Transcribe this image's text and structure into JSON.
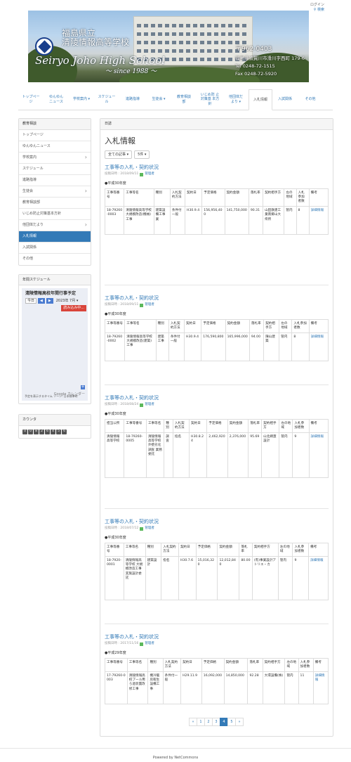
{
  "topbar": {
    "login": "ログイン",
    "search": "検索"
  },
  "header": {
    "school_jp_1": "福島県立",
    "school_jp_2": "清陵情報高等学校",
    "school_en": "Seiryo Joho High School",
    "since": "～ since 1988 ～",
    "zip": "〒962-0403",
    "address": "福島県須賀川市滑川字西町 179-6",
    "tel": "Tel 0248-72-1515",
    "fax": "Fax 0248-72-5920"
  },
  "nav": [
    {
      "label": "トップペー ジ"
    },
    {
      "label": "ゆんゆん ニュース"
    },
    {
      "label": "学校案内 ▾"
    },
    {
      "label": "スケジュー ル"
    },
    {
      "label": "進路指導"
    },
    {
      "label": "生徒会 ▾"
    },
    {
      "label": "教育相談 部"
    },
    {
      "label": "いじめ防 止対策基 本方針"
    },
    {
      "label": "他団体だ より ▾"
    },
    {
      "label": "入札情報"
    },
    {
      "label": "入試関係"
    },
    {
      "label": "その他"
    }
  ],
  "sidebar": {
    "menu_title": "教育相談",
    "items": [
      {
        "label": "トップページ"
      },
      {
        "label": "ゆんゆんニュース"
      },
      {
        "label": "学校案内"
      },
      {
        "label": "スケジュール"
      },
      {
        "label": "進路指導"
      },
      {
        "label": "生徒会"
      },
      {
        "label": "教育相談部"
      },
      {
        "label": "いじめ防止対策基本方針"
      },
      {
        "label": "他団体だより"
      },
      {
        "label": "入札情報"
      },
      {
        "label": "入試関係"
      },
      {
        "label": "その他"
      }
    ],
    "schedule_title": "年間スケジュール",
    "calendar_title": "清陵情報高校年間行事予定",
    "calendar_today": "今日",
    "calendar_prev": "◀",
    "calendar_next": "▶",
    "calendar_month": "2023年 7月 ▾",
    "calendar_loading": "読み込み中...",
    "calendar_footer": "予定を表示するタイム ゾーン: 日本標準時",
    "calendar_google": "Google カレンダー",
    "counter_title": "カウンタ",
    "counter_digits": [
      "0",
      "0",
      "8",
      "2",
      "6",
      "4",
      "5",
      "6"
    ]
  },
  "main": {
    "breadcrumb": "日誌",
    "title": "入札情報",
    "filter_all": "全ての記事 ▾",
    "filter_count": "5件 ▾",
    "headers_a": [
      "工事等番号",
      "工事等名",
      "種別",
      "入札契約方法",
      "契約日",
      "予定価格",
      "契約金額",
      "落札率",
      "契約相手方",
      "左の地域",
      "入札参加者数",
      "備考"
    ],
    "headers_b": [
      "担当公所",
      "工事等番号",
      "工事等名",
      "種別",
      "入札契約方法",
      "契約日",
      "予定価格",
      "契約金額",
      "落札率",
      "契約相手方",
      "左の地域",
      "入札参加者数",
      "備考"
    ],
    "headers_c": [
      "工事等番号",
      "工事等名",
      "種別",
      "入札契約方法",
      "契約日",
      "予定価格",
      "契約金額",
      "落札率",
      "契約相手方",
      "左の地域",
      "入札参加者数",
      "備考"
    ],
    "articles": [
      {
        "title": "工事等の入札・契約状況",
        "meta": "投稿日時 : 2018/09/11",
        "author": "管理者",
        "year": "●平成30年度",
        "row": [
          "18-79260-0003",
          "清陵情報高等学校大規模改造(機械)工事",
          "建築設備工事業",
          "条件付一般",
          "H30.9.4",
          "156,956,400",
          "141,750,000",
          "90.31",
          "山田鉄建工業南郷山大県所",
          "管内",
          "8",
          "詳細情報"
        ]
      },
      {
        "title": "工事等の入札・契約状況",
        "meta": "投稿日時 : 2018/09/11",
        "author": "管理者",
        "year": "●平成30年度",
        "row": [
          "18-79260-0002",
          "清陵情報高等学校大規模改造(建築)工事",
          "建築工事",
          "条件付一般",
          "H30.9.4",
          "176,590,800",
          "165,996,000",
          "94.00",
          "陳山建築",
          "管内",
          "8",
          "詳細情報"
        ]
      },
      {
        "title": "工事等の入札・契約状況",
        "meta": "投稿日時 : 2018/08/24",
        "author": "管理者",
        "year": "●平成30年度",
        "row": [
          "清陵情報高等学校",
          "18-79260-0005",
          "清陵情報高等学校 外壁劣化調査 業務委託",
          "調査",
          "指名",
          "H30.8.24",
          "2,462,920",
          "2,376,000",
          "95.69",
          "山北網蓋設計",
          "管内",
          "9",
          "詳細情報"
        ]
      },
      {
        "title": "工事等の入札・契約状況",
        "meta": "投稿日時 : 2018/07/12",
        "author": "管理者",
        "year": "●平成30年度",
        "row": [
          "18-7920-0001",
          "清陵情報高等学校 大規模改造工事 実施設計委託",
          "建築設計",
          "指名",
          "H30.7.6",
          "15,016,320",
          "12,012,840",
          "80.00",
          "(有)事業設計アトリエ・カ",
          "管内",
          "9",
          "詳細情報"
        ]
      },
      {
        "title": "工事等の入札・契約状況",
        "meta": "投稿日時 : 2017/11/16",
        "author": "管理者",
        "year": "●平成29年度",
        "row": [
          "17-79260-0003",
          "清陵情報高校プール用ろ過装置改修工事",
          "機冷暖房衛生設備工事",
          "条件付一般",
          "H29.11.9",
          "16,092,000",
          "14,850,000",
          "92.28",
          "大環設備(株)",
          "管内",
          "11",
          "詳細情報"
        ]
      }
    ],
    "pager": [
      "«",
      "1",
      "2",
      "3",
      "4",
      "5",
      "»"
    ],
    "pager_current": "4"
  },
  "footer": "Powered by NetCommons"
}
